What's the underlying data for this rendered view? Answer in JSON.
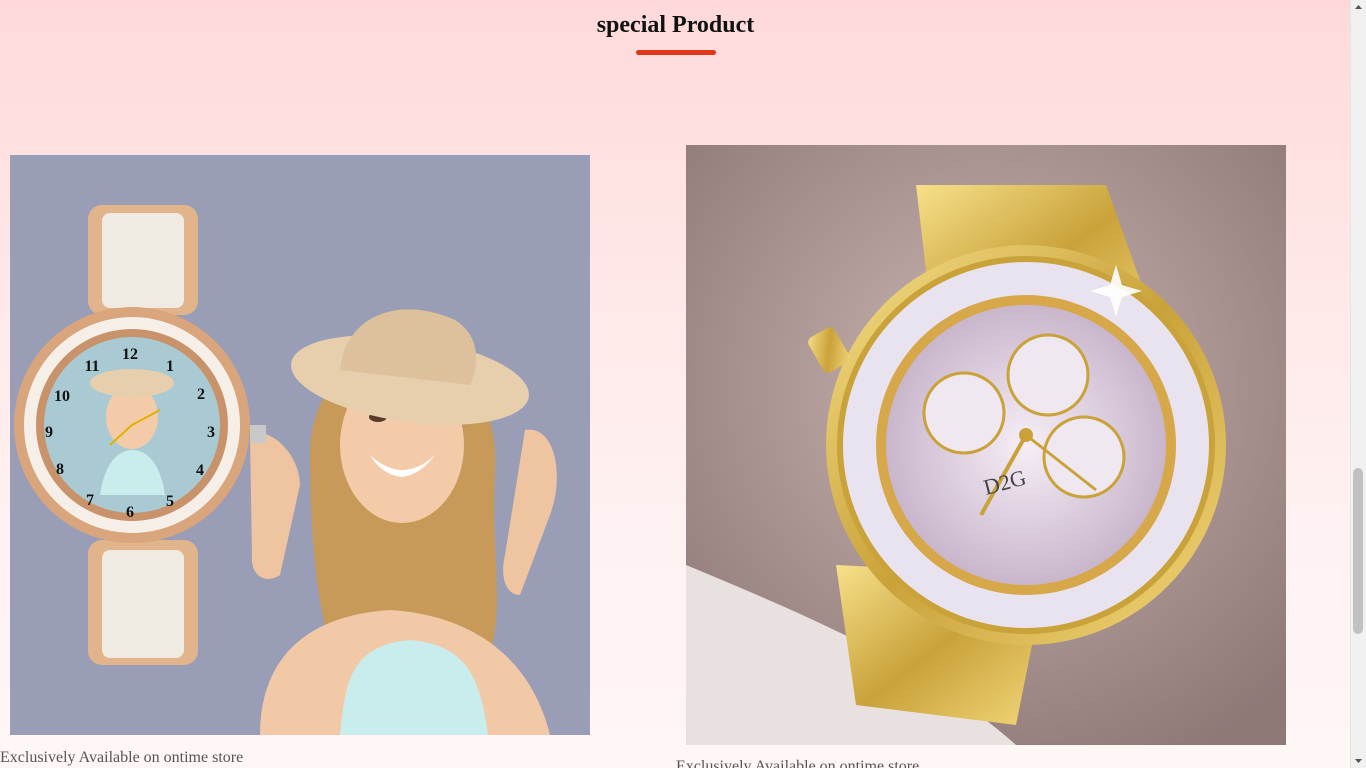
{
  "section": {
    "title": "special Product"
  },
  "products": [
    {
      "image_subject": "rose gold photo watch with smiling woman in sun hat",
      "caption": "Exclusively Available on ontime store",
      "dial_numbers": [
        "12",
        "1",
        "2",
        "3",
        "4",
        "5",
        "6",
        "7",
        "8",
        "9",
        "10",
        "11"
      ]
    },
    {
      "image_subject": "gold crystal studded chronograph wrist watch",
      "caption": "Exclusively Available on ontime store",
      "dial_brand": "D2G"
    }
  ],
  "colors": {
    "accent": "#e2351a",
    "background_top": "#ffd9d9",
    "background_bottom": "#fff6f6",
    "caption_text": "#555555",
    "photo_backdrop": "#9a9db6"
  }
}
